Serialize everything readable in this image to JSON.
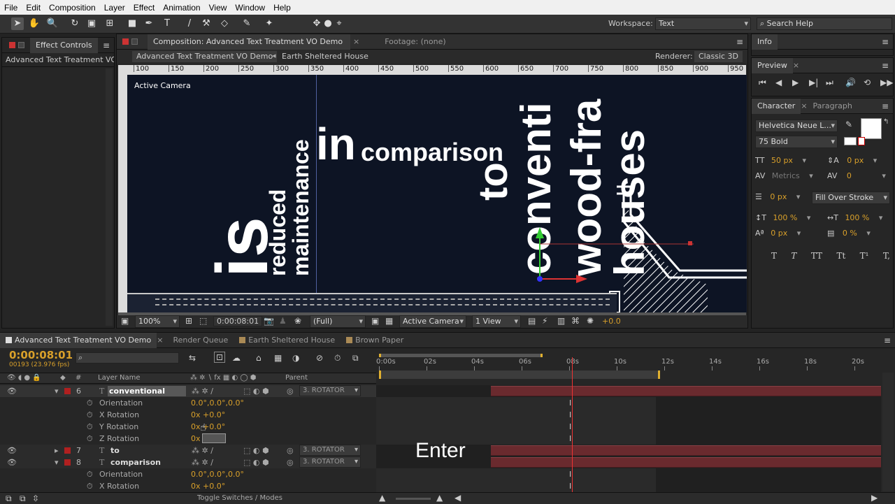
{
  "menu": [
    "File",
    "Edit",
    "Composition",
    "Layer",
    "Effect",
    "Animation",
    "View",
    "Window",
    "Help"
  ],
  "workspace": {
    "label": "Workspace:",
    "value": "Text"
  },
  "search_help": "Search Help",
  "effect_controls": {
    "tab": "Effect Controls",
    "layer": "Advanced Text Treatment VO D"
  },
  "comp_panel": {
    "tab": "Composition: Advanced Text Treatment VO Demo",
    "footage_tab": "Footage: (none)",
    "crumb1": "Advanced Text Treatment VO Demo",
    "crumb2": "Earth Sheltered House",
    "renderer_label": "Renderer:",
    "renderer": "Classic 3D",
    "camera_label": "Active Camera",
    "ruler_ticks": [
      "100",
      "150",
      "200",
      "250",
      "300",
      "350",
      "400",
      "450",
      "500",
      "550",
      "600",
      "650",
      "700",
      "750",
      "800",
      "850",
      "900",
      "950"
    ],
    "footer": {
      "zoom": "100%",
      "timecode": "0:00:08:01",
      "resolution": "(Full)",
      "view": "Active Camera",
      "views": "1 View",
      "exposure": "+0.0"
    }
  },
  "canvas_text": {
    "is": "is",
    "reduced": "reduced",
    "maintenance": "maintenance",
    "in": "in",
    "comparison": "comparison",
    "to": "to",
    "conventi": "conventi",
    "woodfra": "wood-fra",
    "houses": "houses"
  },
  "info": {
    "tab": "Info"
  },
  "preview": {
    "tab": "Preview"
  },
  "character": {
    "tab": "Character",
    "tab2": "Paragraph",
    "font": "Helvetica Neue L...",
    "style": "75 Bold",
    "size": "50 px",
    "leading": "0 px",
    "kerning": "Metrics",
    "tracking": "0",
    "stroke": "0 px",
    "stroke_mode": "Fill Over Stroke",
    "vscale": "100 %",
    "hscale": "100 %",
    "baseline": "0 px",
    "tsume": "0 %",
    "style_buttons": [
      "T",
      "T",
      "TT",
      "Tt",
      "T¹",
      "T,"
    ]
  },
  "timeline": {
    "tabs": [
      "Advanced Text Treatment VO Demo",
      "Render Queue",
      "Earth Sheltered House",
      "Brown Paper"
    ],
    "timecode": "0:00:08:01",
    "frames": "00193 (23.976 fps)",
    "time_ticks": [
      "0:00s",
      "02s",
      "04s",
      "06s",
      "08s",
      "10s",
      "12s",
      "14s",
      "16s",
      "18s",
      "20s"
    ],
    "col_num": "#",
    "col_layer": "Layer Name",
    "col_parent": "Parent",
    "layers": [
      {
        "num": "6",
        "name": "conventional",
        "parent": "3. ROTATOR"
      },
      {
        "num": "7",
        "name": "to",
        "parent": "3. ROTATOR"
      },
      {
        "num": "8",
        "name": "comparison",
        "parent": "3. ROTATOR"
      }
    ],
    "props6": [
      {
        "name": "Orientation",
        "value": "0.0°,0.0°,0.0°"
      },
      {
        "name": "X Rotation",
        "value": "0x +0.0°"
      },
      {
        "name": "Y Rotation",
        "value": "0x +0.0°"
      },
      {
        "name": "Z Rotation",
        "value": "0x +0.0"
      }
    ],
    "props8": [
      {
        "name": "Orientation",
        "value": "0.0°,0.0°,0.0°"
      },
      {
        "name": "X Rotation",
        "value": "0x +0.0°"
      }
    ],
    "toggle": "Toggle Switches / Modes",
    "overlay": "Enter"
  },
  "colors": {
    "accent": "#d9a02a",
    "layer_red": "#b02020",
    "bar": "#6a2a2e",
    "canvas": "#0d1424"
  }
}
